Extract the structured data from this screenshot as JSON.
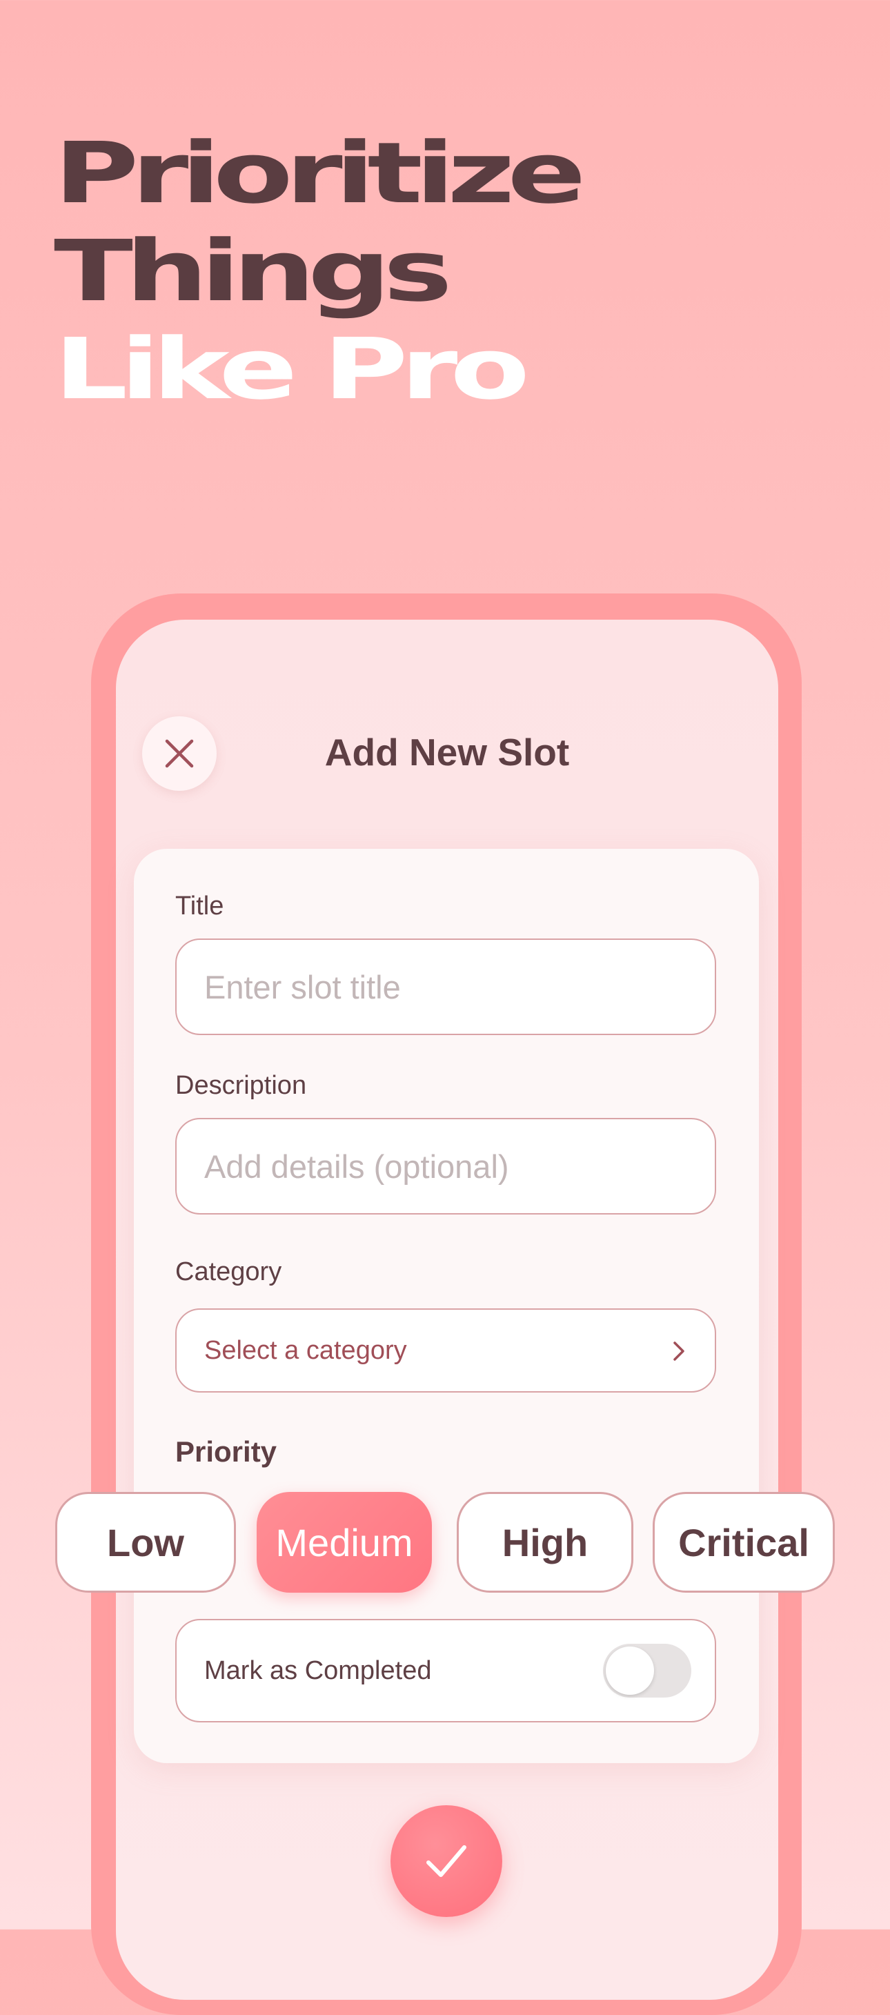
{
  "headline": {
    "line1": "Prioritize",
    "line2": "Things",
    "line3": "Like Pro"
  },
  "screen": {
    "title": "Add New Slot",
    "close_icon": "close-icon",
    "confirm_icon": "checkmark-icon"
  },
  "form": {
    "title_label": "Title",
    "title_placeholder": "Enter slot title",
    "description_label": "Description",
    "description_placeholder": "Add details (optional)",
    "category_label": "Category",
    "category_value": "Select a category",
    "category_icon": "chevron-right-icon",
    "priority_label": "Priority",
    "priorities": [
      "Low",
      "Medium",
      "High",
      "Critical"
    ],
    "selected_priority": "Medium",
    "completed_label": "Mark as Completed",
    "completed": false
  },
  "colors": {
    "background_top": "#ffb6b6",
    "accent": "#ff7682",
    "frame": "#ff9ea0",
    "text_dark": "#5e3f44"
  }
}
